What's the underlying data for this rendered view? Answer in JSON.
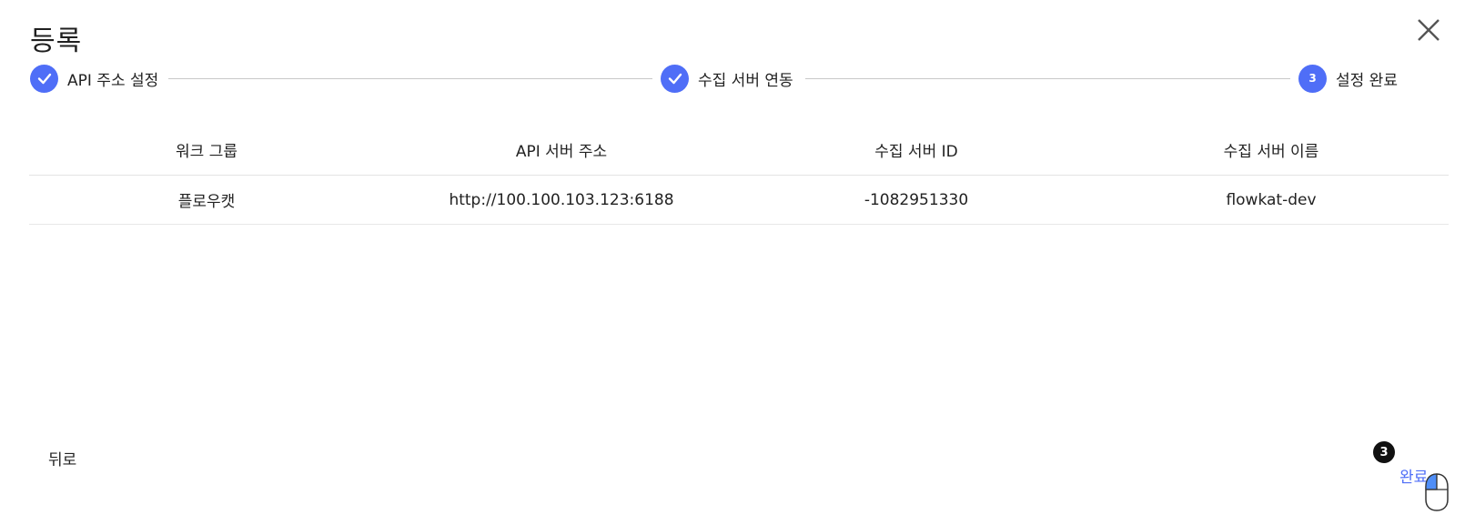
{
  "dialog": {
    "title": "등록",
    "close_icon": "close-icon"
  },
  "stepper": {
    "steps": [
      {
        "label": "API 주소 설정",
        "state": "done",
        "icon": "check-icon"
      },
      {
        "label": "수집 서버 연동",
        "state": "done",
        "icon": "check-icon"
      },
      {
        "label": "설정 완료",
        "state": "current",
        "number": "3"
      }
    ],
    "accent_color": "#4f6ef7"
  },
  "table": {
    "columns": [
      "워크 그룹",
      "API 서버 주소",
      "수집 서버 ID",
      "수집 서버 이름"
    ],
    "rows": [
      [
        "플로우캣",
        "http://100.100.103.123:6188",
        "-1082951330",
        "flowkat-dev"
      ]
    ]
  },
  "footer": {
    "back_label": "뒤로",
    "finish_label": "완료"
  },
  "cursor_overlay": {
    "badge": "3",
    "icon": "mouse-left-click-icon"
  }
}
